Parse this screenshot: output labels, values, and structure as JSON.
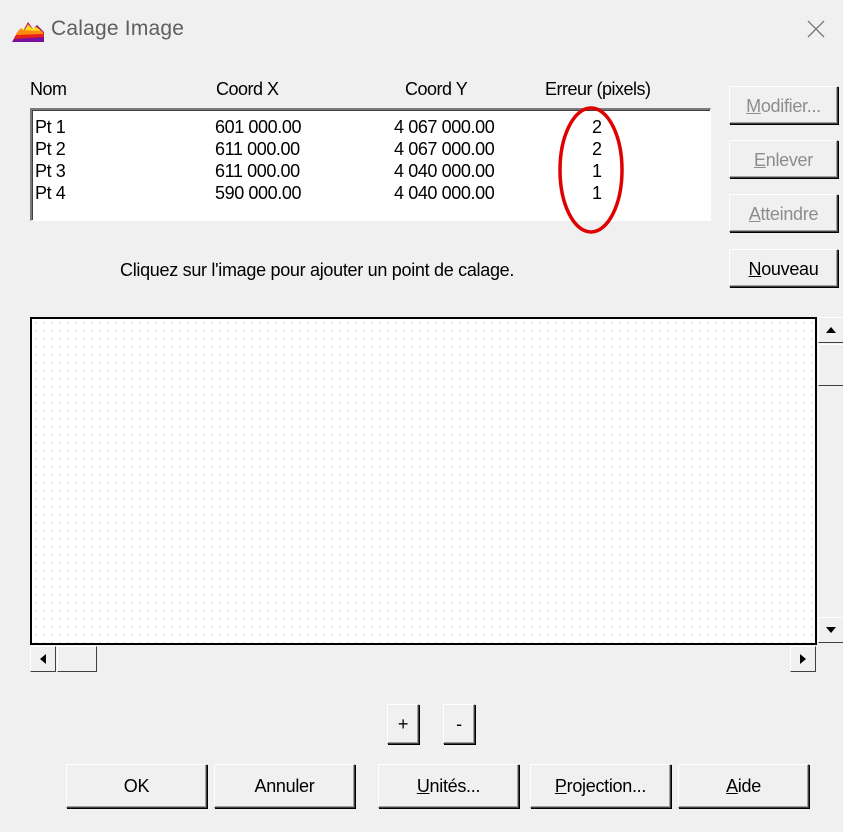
{
  "window": {
    "title": "Calage Image",
    "icon": "mountain-app-icon",
    "close_icon": "close-icon"
  },
  "columns": [
    "Nom",
    "Coord X",
    "Coord Y",
    "Erreur (pixels)"
  ],
  "points": [
    {
      "name": "Pt 1",
      "x": "601 000.00",
      "y": "4 067 000.00",
      "error": "2"
    },
    {
      "name": "Pt 2",
      "x": "611 000.00",
      "y": "4 067 000.00",
      "error": "2"
    },
    {
      "name": "Pt 3",
      "x": "611 000.00",
      "y": "4 040 000.00",
      "error": "1"
    },
    {
      "name": "Pt 4",
      "x": "590 000.00",
      "y": "4 040 000.00",
      "error": "1"
    }
  ],
  "side_buttons": {
    "modifier": {
      "underline": "M",
      "rest": "odifier..."
    },
    "enlever": {
      "underline": "E",
      "rest": "nlever"
    },
    "atteindre": {
      "underline": "A",
      "rest": "tteindre"
    },
    "nouveau": {
      "underline": "N",
      "rest": "ouveau"
    }
  },
  "hint": "Cliquez sur l'image pour ajouter un point de calage.",
  "zoom": {
    "plus": "+",
    "minus": "-"
  },
  "bottom_buttons": {
    "ok": "OK",
    "annuler": "Annuler",
    "unites": {
      "underline": "U",
      "rest": "nités..."
    },
    "projection": {
      "underline": "P",
      "rest": "rojection..."
    },
    "aide": {
      "underline": "A",
      "rest": "ide"
    }
  },
  "colors": {
    "annotation": "#e00000",
    "disabled_text": "#8d8d8d",
    "face": "#f0f0f0"
  }
}
